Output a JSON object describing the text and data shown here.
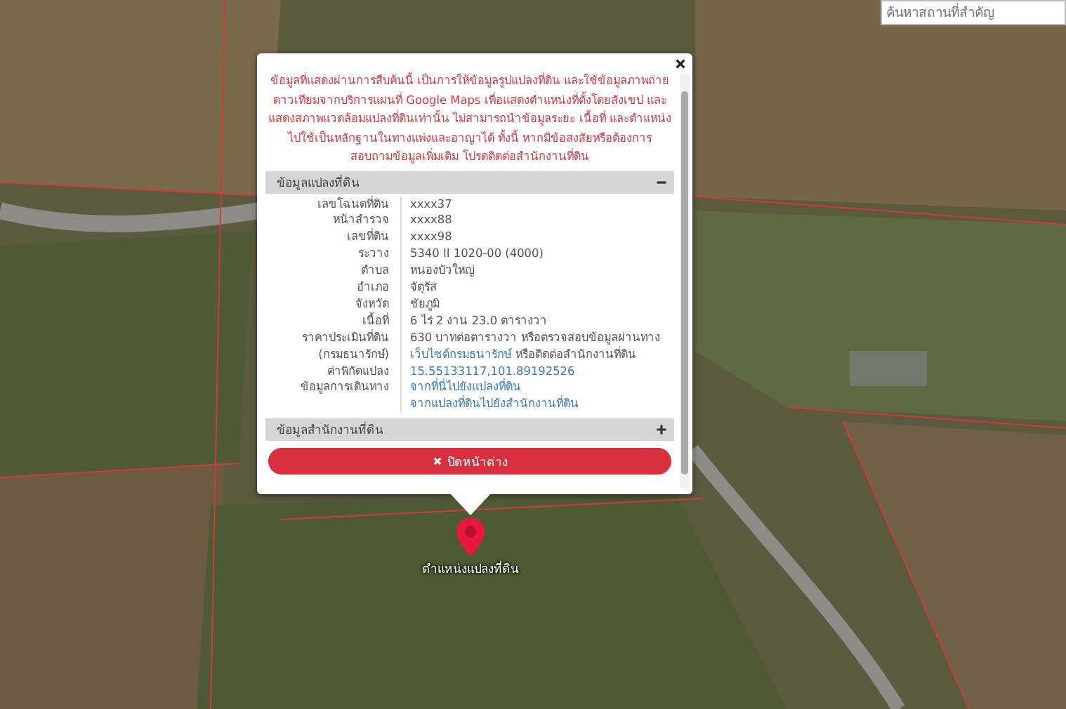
{
  "search": {
    "placeholder": "ค้นหาสถานที่สำคัญ"
  },
  "popup": {
    "notice": "ข้อมูลที่แสดงผ่านการสืบค้นนี้ เป็นการให้ข้อมูลรูปแปลงที่ดิน และใช้ข้อมูลภาพถ่ายดาวเทียมจากบริการแผนที่ Google Maps เพื่อแสดงตำแหน่งที่ตั้งโดยสังเขป และแสดงสภาพแวดล้อมแปลงที่ดินเท่านั้น ไม่สามารถนำข้อมูลระยะ เนื้อที่ และตำแหน่ง ไปใช้เป็นหลักฐานในทางแพ่งและอาญาได้ ทั้งนี้ หากมีข้อสงสัยหรือต้องการสอบถามข้อมูลเพิ่มเติม โปรดติดต่อสำนักงานที่ดิน",
    "sections": [
      {
        "title": "ข้อมูลแปลงที่ดิน",
        "expanded": true,
        "rows": [
          {
            "label": "เลขโฉนดที่ดิน",
            "parts": [
              {
                "text": "xxxx37",
                "kind": "text"
              }
            ]
          },
          {
            "label": "หน้าสำรวจ",
            "parts": [
              {
                "text": "xxxx88",
                "kind": "text"
              }
            ]
          },
          {
            "label": "เลขที่ดิน",
            "parts": [
              {
                "text": "xxxx98",
                "kind": "text"
              }
            ]
          },
          {
            "label": "ระวาง",
            "parts": [
              {
                "text": "5340 II 1020-00 (4000)",
                "kind": "text"
              }
            ]
          },
          {
            "label": "ตำบล",
            "parts": [
              {
                "text": "หนองบัวใหญ่",
                "kind": "text"
              }
            ]
          },
          {
            "label": "อำเภอ",
            "parts": [
              {
                "text": "จัตุรัส",
                "kind": "text"
              }
            ]
          },
          {
            "label": "จังหวัด",
            "parts": [
              {
                "text": "ชัยภูมิ",
                "kind": "text"
              }
            ]
          },
          {
            "label": "เนื้อที่",
            "parts": [
              {
                "text": "6 ไร่ 2 งาน 23.0 ตารางวา",
                "kind": "text"
              }
            ]
          },
          {
            "label": "ราคาประเมินที่ดิน",
            "parts": [
              {
                "text": "630 บาทต่อตารางวา หรือตรวจสอบข้อมูลผ่านทาง",
                "kind": "text"
              }
            ]
          },
          {
            "label": "(กรมธนารักษ์)",
            "parts": [
              {
                "text": "เว็บไซต์กรมธนารักษ์",
                "kind": "link"
              },
              {
                "text": "หรือติดต่อสำนักงานที่ดิน",
                "kind": "text"
              }
            ]
          },
          {
            "label": "ค่าพิกัดแปลง",
            "parts": [
              {
                "text": "15.55133117,101.89192526",
                "kind": "link"
              }
            ]
          },
          {
            "label": "ข้อมูลการเดินทาง",
            "parts": [
              {
                "text": "จากที่นี่ไปยังแปลงที่ดิน",
                "kind": "link"
              }
            ]
          },
          {
            "parts": [
              {
                "text": "จากแปลงที่ดินไปยังสำนักงานที่ดิน",
                "kind": "link"
              }
            ]
          }
        ]
      },
      {
        "title": "ข้อมูลสำนักงานที่ดิน",
        "expanded": false
      }
    ],
    "close_button": "ปิดหน้าต่าง"
  },
  "marker": {
    "label": "ตำแหน่งแปลงที่ดิน"
  }
}
